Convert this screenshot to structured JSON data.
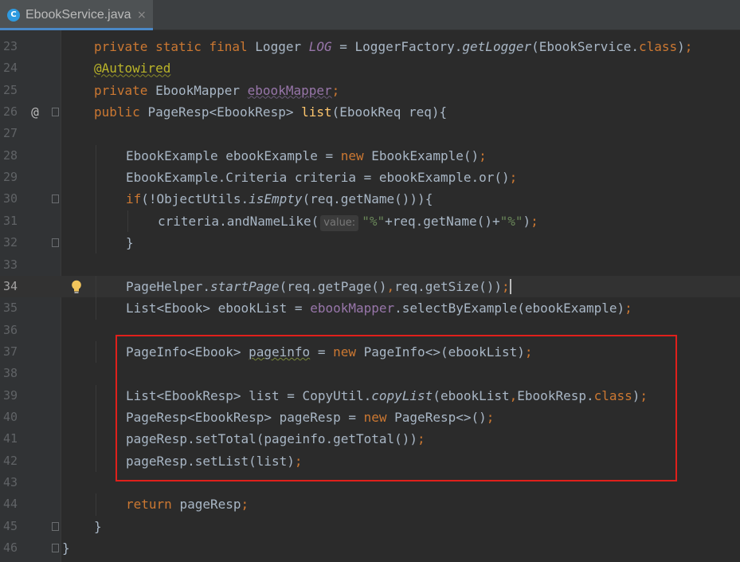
{
  "tab": {
    "title": "EbookService.java",
    "icon": "java-class-icon",
    "close_glyph": "×"
  },
  "editor": {
    "current_line": 34,
    "highlight_box_color": "#e0201b",
    "lines": [
      {
        "num": "23",
        "gutter": "",
        "tokens": [
          [
            "kw",
            "private static final "
          ],
          [
            "",
            "Logger "
          ],
          [
            "fld-it",
            "LOG"
          ],
          [
            "",
            " = LoggerFactory."
          ],
          [
            "it",
            "getLogger"
          ],
          [
            "",
            "(EbookService."
          ],
          [
            "kw",
            "class"
          ],
          [
            "",
            ")"
          ],
          [
            "kw",
            ";"
          ]
        ]
      },
      {
        "num": "24",
        "gutter": "",
        "tokens": [
          [
            "ann",
            "@Autowired"
          ]
        ]
      },
      {
        "num": "25",
        "gutter": "",
        "tokens": [
          [
            "kw",
            "private "
          ],
          [
            "",
            "EbookMapper "
          ],
          [
            "fld-u",
            "ebookMapper"
          ],
          [
            "kw",
            ";"
          ]
        ]
      },
      {
        "num": "26",
        "gutter": "@",
        "fold": true,
        "tokens": [
          [
            "kw",
            "public "
          ],
          [
            "",
            "PageResp<EbookResp> "
          ],
          [
            "meth",
            "list"
          ],
          [
            "",
            "(EbookReq req){"
          ]
        ]
      },
      {
        "num": "27",
        "gutter": "",
        "tokens": []
      },
      {
        "num": "28",
        "gutter": "",
        "indent": 1,
        "tokens": [
          [
            "",
            "EbookExample ebookExample = "
          ],
          [
            "kw",
            "new "
          ],
          [
            "",
            "EbookExample()"
          ],
          [
            "kw",
            ";"
          ]
        ]
      },
      {
        "num": "29",
        "gutter": "",
        "indent": 1,
        "tokens": [
          [
            "",
            "EbookExample.Criteria criteria = ebookExample.or()"
          ],
          [
            "kw",
            ";"
          ]
        ]
      },
      {
        "num": "30",
        "gutter": "",
        "fold": true,
        "indent": 1,
        "tokens": [
          [
            "kw",
            "if"
          ],
          [
            "",
            "(!ObjectUtils."
          ],
          [
            "it",
            "isEmpty"
          ],
          [
            "",
            "(req.getName())){"
          ]
        ]
      },
      {
        "num": "31",
        "gutter": "",
        "indent": 2,
        "tokens": [
          [
            "",
            "criteria.andNameLike("
          ],
          [
            "hint",
            "value:"
          ],
          [
            "str",
            "\"%\""
          ],
          [
            "",
            "+req.getName()+"
          ],
          [
            "str",
            "\"%\""
          ],
          [
            "",
            ")"
          ],
          [
            "kw",
            ";"
          ]
        ]
      },
      {
        "num": "32",
        "gutter": "",
        "fold": true,
        "indent": 1,
        "tokens": [
          [
            "",
            "}"
          ]
        ]
      },
      {
        "num": "33",
        "gutter": "",
        "tokens": []
      },
      {
        "num": "34",
        "gutter": "",
        "bulb": true,
        "indent": 1,
        "tokens": [
          [
            "",
            "PageHelper."
          ],
          [
            "it",
            "startPage"
          ],
          [
            "",
            "(req.getPage()"
          ],
          [
            "kw",
            ","
          ],
          [
            "",
            "req.getSize())"
          ],
          [
            "kw",
            ";"
          ],
          [
            "cursor",
            ""
          ]
        ]
      },
      {
        "num": "35",
        "gutter": "",
        "indent": 1,
        "tokens": [
          [
            "",
            "List<Ebook> ebookList = "
          ],
          [
            "fld",
            "ebookMapper"
          ],
          [
            "",
            ".selectByExample(ebookExample)"
          ],
          [
            "kw",
            ";"
          ]
        ]
      },
      {
        "num": "36",
        "gutter": "",
        "tokens": []
      },
      {
        "num": "37",
        "gutter": "",
        "indent": 1,
        "tokens": [
          [
            "",
            "PageInfo<Ebook> "
          ],
          [
            "warn",
            "pageinfo"
          ],
          [
            "",
            " = "
          ],
          [
            "kw",
            "new "
          ],
          [
            "",
            "PageInfo<>(ebookList)"
          ],
          [
            "kw",
            ";"
          ]
        ]
      },
      {
        "num": "38",
        "gutter": "",
        "tokens": []
      },
      {
        "num": "39",
        "gutter": "",
        "indent": 1,
        "tokens": [
          [
            "",
            "List<EbookResp> list = CopyUtil."
          ],
          [
            "it",
            "copyList"
          ],
          [
            "",
            "(ebookList"
          ],
          [
            "kw",
            ","
          ],
          [
            "",
            "EbookResp."
          ],
          [
            "kw",
            "class"
          ],
          [
            "",
            ")"
          ],
          [
            "kw",
            ";"
          ]
        ]
      },
      {
        "num": "40",
        "gutter": "",
        "indent": 1,
        "tokens": [
          [
            "",
            "PageResp<EbookResp> pageResp = "
          ],
          [
            "kw",
            "new "
          ],
          [
            "",
            "PageResp<>()"
          ],
          [
            "kw",
            ";"
          ]
        ]
      },
      {
        "num": "41",
        "gutter": "",
        "indent": 1,
        "tokens": [
          [
            "",
            "pageResp.setTotal(pageinfo.getTotal())"
          ],
          [
            "kw",
            ";"
          ]
        ]
      },
      {
        "num": "42",
        "gutter": "",
        "indent": 1,
        "tokens": [
          [
            "",
            "pageResp.setList(list)"
          ],
          [
            "kw",
            ";"
          ]
        ]
      },
      {
        "num": "43",
        "gutter": "",
        "tokens": []
      },
      {
        "num": "44",
        "gutter": "",
        "indent": 1,
        "tokens": [
          [
            "kw",
            "return "
          ],
          [
            "",
            "pageResp"
          ],
          [
            "kw",
            ";"
          ]
        ]
      },
      {
        "num": "45",
        "gutter": "",
        "fold": true,
        "tokens": [
          [
            "",
            "}"
          ]
        ]
      },
      {
        "num": "46",
        "gutter": "",
        "fold": true,
        "outdent": true,
        "tokens": [
          [
            "",
            "}"
          ]
        ]
      }
    ]
  }
}
